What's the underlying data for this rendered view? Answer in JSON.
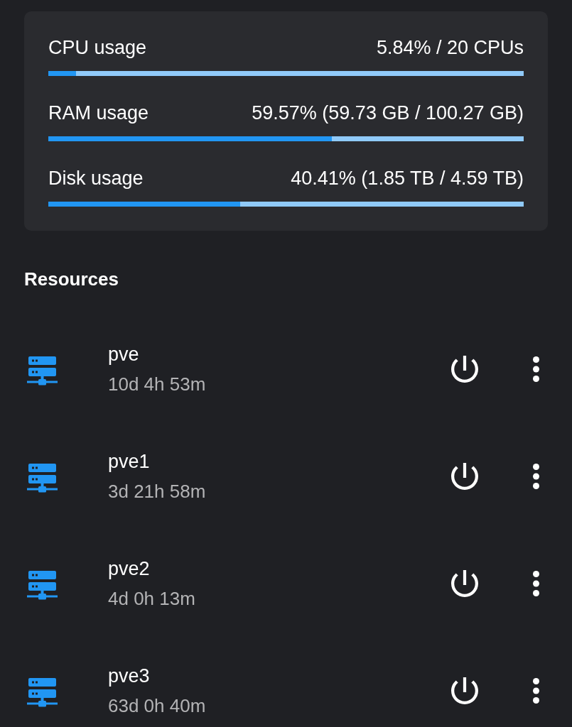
{
  "summary": {
    "metrics": [
      {
        "label": "CPU usage",
        "reading": "5.84% / 20 CPUs",
        "level": 0.0584
      },
      {
        "label": "RAM usage",
        "reading": "59.57% (59.73 GB / 100.27 GB)",
        "level": 0.5957
      },
      {
        "label": "Disk usage",
        "reading": "40.41% (1.85 TB / 4.59 TB)",
        "level": 0.4041
      }
    ]
  },
  "resources": {
    "title": "Resources",
    "nodes": [
      {
        "name": "pve",
        "uptime": "10d 4h 53m"
      },
      {
        "name": "pve1",
        "uptime": "3d 21h 58m"
      },
      {
        "name": "pve2",
        "uptime": "4d 0h 13m"
      },
      {
        "name": "pve3",
        "uptime": "63d 0h 40m"
      }
    ]
  }
}
